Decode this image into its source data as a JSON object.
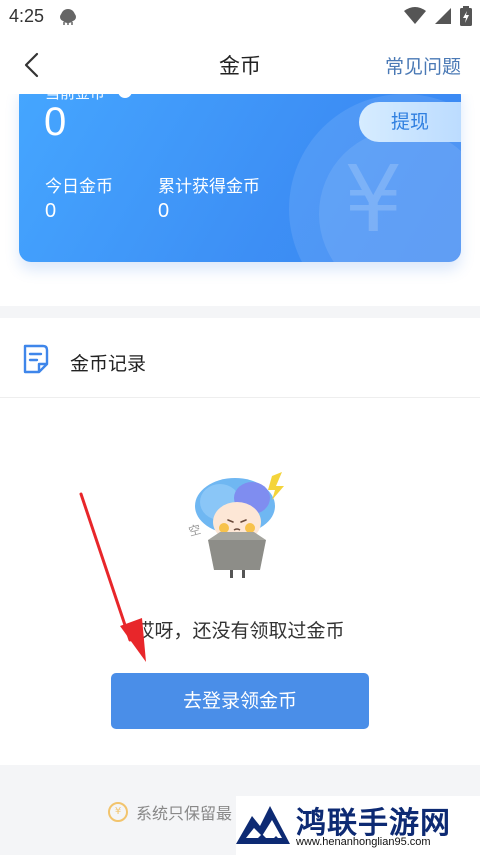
{
  "status_bar": {
    "time": "4:25"
  },
  "nav": {
    "title": "金币",
    "faq": "常见问题"
  },
  "coin_card": {
    "current_label": "当前金币",
    "current_value": "0",
    "withdraw_label": "提现",
    "today_label": "今日金币",
    "today_value": "0",
    "total_label": "累计获得金币",
    "total_value": "0",
    "yen_symbol": "¥"
  },
  "records": {
    "title": "金币记录",
    "empty_text": "哎呀，还没有领取过金币",
    "login_button": "去登录领金币"
  },
  "footer": {
    "note": "系统只保留最"
  },
  "watermark": {
    "title": "鸿联手游网",
    "url": "www.henanhonglian95.com"
  },
  "colors": {
    "accent": "#4a8ee8",
    "faq": "#4a79b5",
    "card_start": "#45a6ff",
    "card_end": "#3a86f2",
    "arrow": "#e8262a"
  },
  "icons": [
    "back-chevron-icon",
    "cloud-icon",
    "wifi-icon",
    "signal-icon",
    "battery-icon",
    "info-icon",
    "document-icon",
    "coin-icon"
  ]
}
